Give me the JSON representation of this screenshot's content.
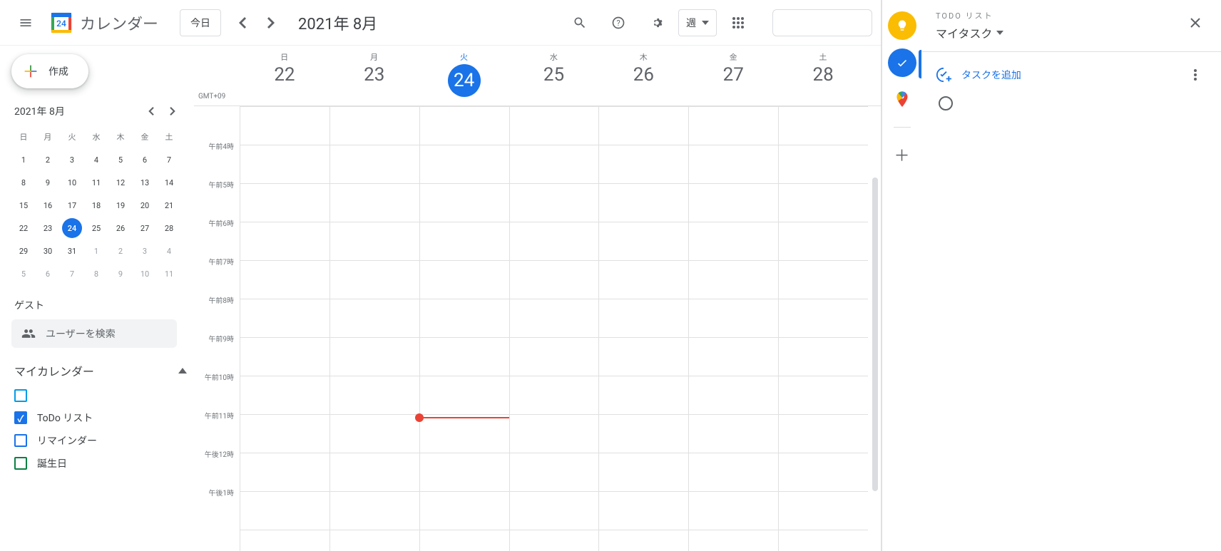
{
  "header": {
    "appTitle": "カレンダー",
    "logoDay": "24",
    "todayLabel": "今日",
    "dateTitle": "2021年 8月",
    "viewLabel": "週"
  },
  "miniCalendar": {
    "title": "2021年 8月",
    "dayHeaders": [
      "日",
      "月",
      "火",
      "水",
      "木",
      "金",
      "土"
    ],
    "rows": [
      [
        {
          "n": "1"
        },
        {
          "n": "2"
        },
        {
          "n": "3"
        },
        {
          "n": "4"
        },
        {
          "n": "5"
        },
        {
          "n": "6"
        },
        {
          "n": "7"
        }
      ],
      [
        {
          "n": "8"
        },
        {
          "n": "9"
        },
        {
          "n": "10"
        },
        {
          "n": "11"
        },
        {
          "n": "12"
        },
        {
          "n": "13"
        },
        {
          "n": "14"
        }
      ],
      [
        {
          "n": "15"
        },
        {
          "n": "16"
        },
        {
          "n": "17"
        },
        {
          "n": "18"
        },
        {
          "n": "19"
        },
        {
          "n": "20"
        },
        {
          "n": "21"
        }
      ],
      [
        {
          "n": "22"
        },
        {
          "n": "23"
        },
        {
          "n": "24",
          "today": true
        },
        {
          "n": "25"
        },
        {
          "n": "26"
        },
        {
          "n": "27"
        },
        {
          "n": "28"
        }
      ],
      [
        {
          "n": "29"
        },
        {
          "n": "30"
        },
        {
          "n": "31"
        },
        {
          "n": "1",
          "dim": true
        },
        {
          "n": "2",
          "dim": true
        },
        {
          "n": "3",
          "dim": true
        },
        {
          "n": "4",
          "dim": true
        }
      ],
      [
        {
          "n": "5",
          "dim": true
        },
        {
          "n": "6",
          "dim": true
        },
        {
          "n": "7",
          "dim": true
        },
        {
          "n": "8",
          "dim": true
        },
        {
          "n": "9",
          "dim": true
        },
        {
          "n": "10",
          "dim": true
        },
        {
          "n": "11",
          "dim": true
        }
      ]
    ]
  },
  "sidebar": {
    "createLabel": "作成",
    "guestTitle": "ゲスト",
    "guestSearchPlaceholder": "ユーザーを検索",
    "myCalendarsTitle": "マイカレンダー",
    "calendars": [
      {
        "label": "",
        "color": "#039be5",
        "checked": false
      },
      {
        "label": "ToDo リスト",
        "color": "#1a73e8",
        "checked": true
      },
      {
        "label": "リマインダー",
        "color": "#1a73e8",
        "checked": false
      },
      {
        "label": "誕生日",
        "color": "#0b8043",
        "checked": false
      }
    ]
  },
  "week": {
    "timezone": "GMT+09",
    "days": [
      {
        "short": "日",
        "num": "22"
      },
      {
        "short": "月",
        "num": "23"
      },
      {
        "short": "火",
        "num": "24",
        "today": true
      },
      {
        "short": "水",
        "num": "25"
      },
      {
        "short": "木",
        "num": "26"
      },
      {
        "short": "金",
        "num": "27"
      },
      {
        "short": "土",
        "num": "28"
      }
    ],
    "hours": [
      "",
      "午前4時",
      "午前5時",
      "午前6時",
      "午前7時",
      "午前8時",
      "午前9時",
      "午前10時",
      "午前11時",
      "午後12時",
      "午後1時"
    ],
    "nowDayIndex": 2,
    "nowHourOffset": 8.05
  },
  "tasks": {
    "todoLabel": "TODO リスト",
    "listName": "マイタスク",
    "addLabel": "タスクを追加"
  }
}
